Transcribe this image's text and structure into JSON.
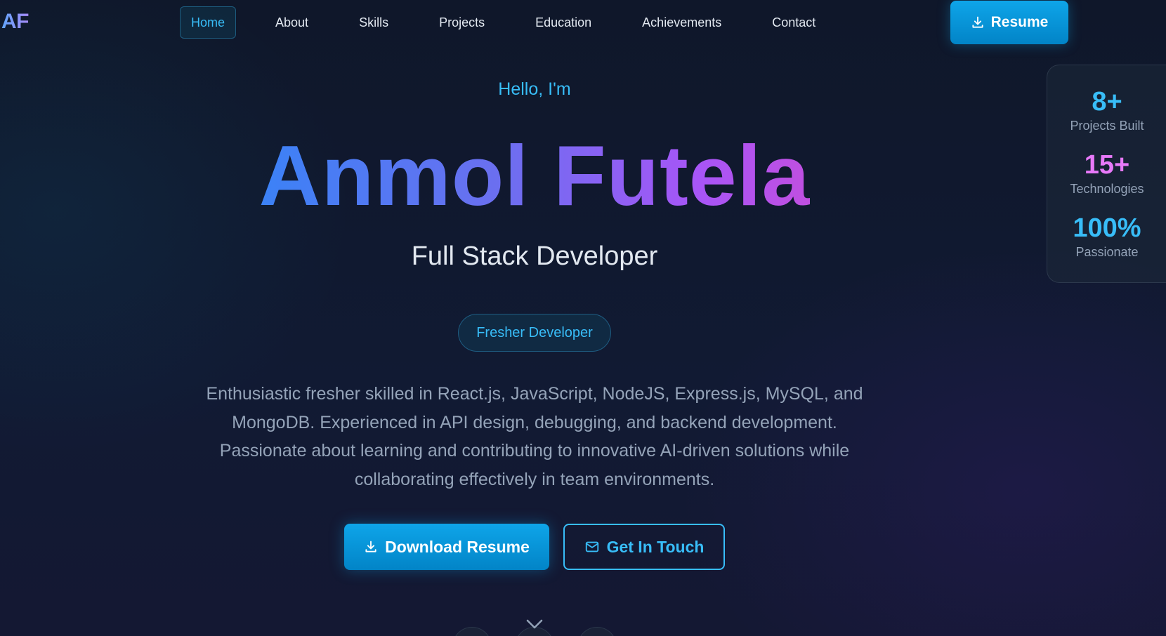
{
  "nav": {
    "logo": "AF",
    "items": [
      {
        "label": "Home",
        "active": true
      },
      {
        "label": "About"
      },
      {
        "label": "Skills"
      },
      {
        "label": "Projects"
      },
      {
        "label": "Education"
      },
      {
        "label": "Achievements"
      },
      {
        "label": "Contact"
      }
    ],
    "resume_label": "Resume"
  },
  "hero": {
    "greeting": "Hello, I'm",
    "name": "Anmol Futela",
    "role": "Full Stack Developer",
    "badge": "Fresher Developer",
    "description": "Enthusiastic fresher skilled in React.js, JavaScript, NodeJS, Express.js, MySQL, and MongoDB. Experienced in API design, debugging, and backend development. Passionate about learning and contributing to innovative AI-driven solutions while collaborating effectively in team environments.",
    "primary_cta": "Download Resume",
    "secondary_cta": "Get In Touch"
  },
  "stats": [
    {
      "value": "8+",
      "label": "Projects Built",
      "color": "#38bdf8"
    },
    {
      "value": "15+",
      "label": "Technologies",
      "color": "#e879f9"
    },
    {
      "value": "100%",
      "label": "Passionate",
      "color": "#38bdf8"
    }
  ],
  "icons": {
    "resume": "download-icon",
    "download": "download-icon",
    "contact": "mail-icon",
    "scroll": "chevron-down-icon"
  },
  "colors": {
    "accent": "#38bdf8",
    "button": "#0ea5e9",
    "background": "#0f172a",
    "gradient_start": "#3b82f6",
    "gradient_end": "#c04fe0"
  }
}
